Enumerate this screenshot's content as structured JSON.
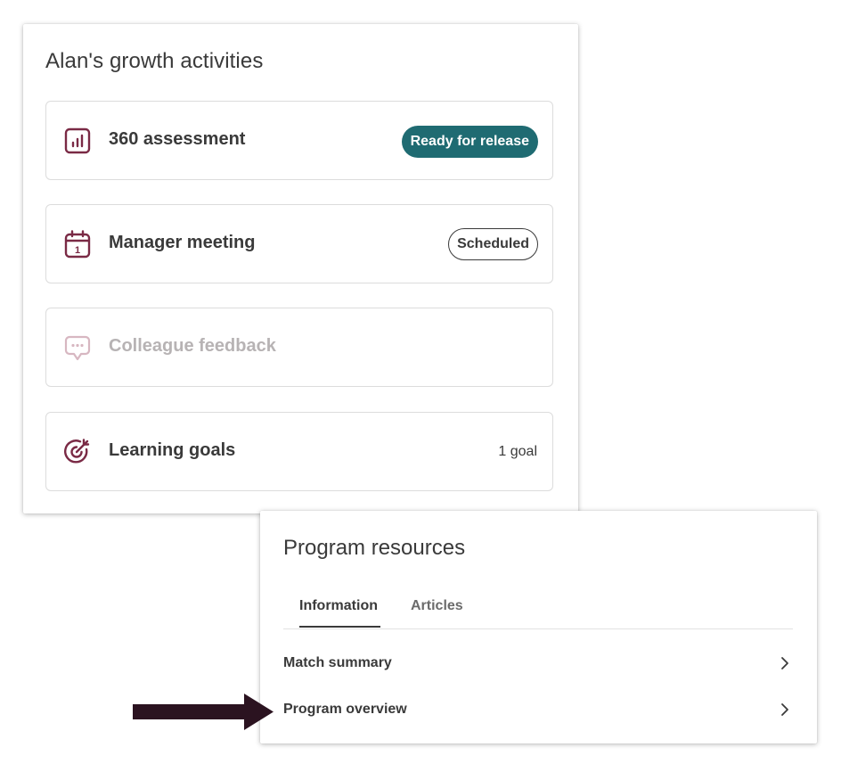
{
  "growth": {
    "title": "Alan's growth activities",
    "activities": [
      {
        "label": "360 assessment",
        "icon": "bar-chart-icon",
        "status": "Ready for release",
        "status_style": "filled"
      },
      {
        "label": "Manager meeting",
        "icon": "calendar-icon",
        "status": "Scheduled",
        "status_style": "outline"
      },
      {
        "label": "Colleague feedback",
        "icon": "chat-bubble-icon",
        "status": "",
        "status_style": "none",
        "disabled": true
      },
      {
        "label": "Learning goals",
        "icon": "target-icon",
        "status": "1 goal",
        "status_style": "text"
      }
    ]
  },
  "resources": {
    "title": "Program resources",
    "tabs": [
      {
        "label": "Information",
        "active": true
      },
      {
        "label": "Articles",
        "active": false
      }
    ],
    "items": [
      {
        "label": "Match summary"
      },
      {
        "label": "Program overview"
      }
    ]
  },
  "colors": {
    "icon_accent": "#7a2a45",
    "icon_disabled": "#d7b7c1",
    "badge_teal": "#1f6b72",
    "arrow": "#2b1320"
  }
}
